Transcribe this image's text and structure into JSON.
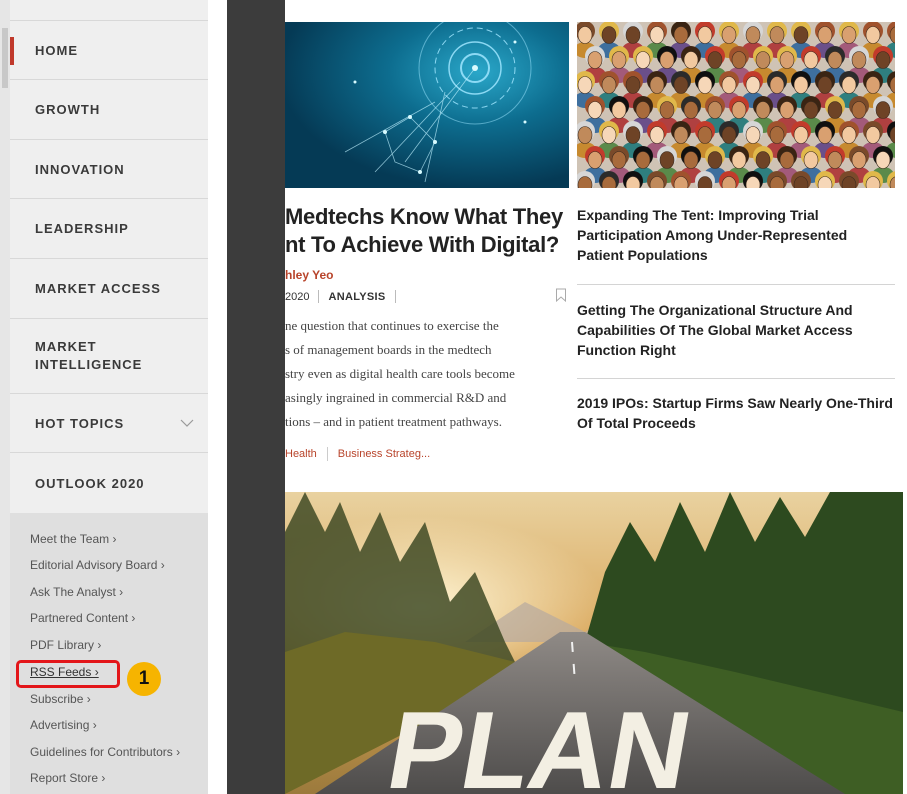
{
  "nav": {
    "items": [
      {
        "label": "HOME",
        "active": true
      },
      {
        "label": "GROWTH"
      },
      {
        "label": "INNOVATION"
      },
      {
        "label": "LEADERSHIP"
      },
      {
        "label": "MARKET ACCESS"
      },
      {
        "label": "MARKET INTELLIGENCE"
      },
      {
        "label": "HOT TOPICS",
        "has_submenu": true,
        "icon": "chevron-down-icon"
      },
      {
        "label": "OUTLOOK 2020"
      }
    ]
  },
  "links": [
    "Meet the Team ›",
    "Editorial Advisory Board ›",
    "Ask The Analyst ›",
    "Partnered Content ›",
    "PDF Library ›",
    "RSS Feeds ›",
    "Subscribe ›",
    "Advertising ›",
    "Guidelines for Contributors ›",
    "Report Store ›"
  ],
  "callout": {
    "number": "1",
    "highlight_color": "#e3161a",
    "badge_color": "#f6b400"
  },
  "featured": {
    "headline_line1": "Medtechs Know What They",
    "headline_line2": "nt To Achieve With Digital?",
    "author": "hley Yeo",
    "date": "2020",
    "type": "ANALYSIS",
    "summary_lines": [
      "ne question that continues to exercise the",
      "s of management boards in the medtech",
      "stry even as digital health care tools become",
      "asingly ingrained in commercial R&D and",
      "tions –  and in patient treatment pathways."
    ],
    "tags": [
      "Health",
      "Business Strateg..."
    ]
  },
  "side_articles": [
    "Expanding The Tent: Improving Trial Participation Among Under-Represented Patient Populations",
    "Getting The Organizational Structure And Capabilities Of The Global Market Access Function Right",
    "2019 IPOs: Startup Firms Saw Nearly One-Third Of Total Proceeds"
  ],
  "road_text": "PLAN",
  "colors": {
    "accent": "#b8442b",
    "active_marker": "#c0392b",
    "gutter": "#3c3c3c",
    "sidebar": "#efefef"
  }
}
